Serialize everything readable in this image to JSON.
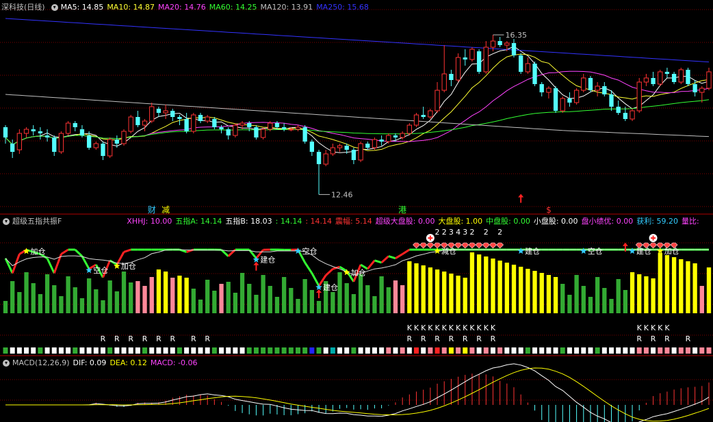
{
  "panels": {
    "main": {
      "title": "深科技(日线)",
      "ma_labels": [
        {
          "text": "MA5: 14.85",
          "color": "#ffffff"
        },
        {
          "text": "MA10: 14.87",
          "color": "#ffff33"
        },
        {
          "text": "MA20: 14.76",
          "color": "#ff44ff"
        },
        {
          "text": "MA60: 14.25",
          "color": "#33ff33"
        },
        {
          "text": "MA120: 13.91",
          "color": "#c0c0c0"
        },
        {
          "text": "MA250: 15.68",
          "color": "#3333ff"
        }
      ],
      "high_label": "16.35",
      "low_label": "12.46",
      "signals": [
        {
          "text": "财",
          "color": "#33ccff"
        },
        {
          "text": "减",
          "color": "#ffff00"
        },
        {
          "text": "港",
          "color": "#33ff33"
        },
        {
          "text": "$",
          "color": "#ff3333"
        }
      ]
    },
    "indicator": {
      "title": "超级五指共振F",
      "labels": [
        {
          "text": "XHHJ: 10.00",
          "color": "#ff44ff"
        },
        {
          "text": "五指A: 14.14",
          "color": "#33ff33"
        },
        {
          "text": "五指B: 18.03",
          "color": "#ffffff"
        },
        {
          "text": ": 14.14",
          "color": "#33ff33"
        },
        {
          "text": ": 14.14",
          "color": "#ff3333"
        },
        {
          "text": "震幅: 5.14",
          "color": "#ff3333"
        },
        {
          "text": "超级大盘股: 0.00",
          "color": "#ff44ff"
        },
        {
          "text": "大盘股: 1.00",
          "color": "#ffff00"
        },
        {
          "text": "中盘股: 0.00",
          "color": "#33ff33"
        },
        {
          "text": "小盘股: 0.00",
          "color": "#ffffff"
        },
        {
          "text": "盘小绩优: 0.00",
          "color": "#ff44ff"
        },
        {
          "text": "获利: 59.20",
          "color": "#33ccff"
        },
        {
          "text": "量比:",
          "color": "#ff44ff"
        }
      ],
      "digit_row": [
        "2",
        "2",
        "3",
        "4",
        "3",
        "2",
        "2",
        "2"
      ],
      "k_mark": "K",
      "r_mark": "R",
      "annotations": [
        {
          "text": "加仓",
          "star": "#ffff00"
        },
        {
          "text": "空仓",
          "star": "#33ccff"
        },
        {
          "text": "加仓",
          "star": "#ffff00"
        },
        {
          "text": "建仓",
          "star": "#33ccff"
        },
        {
          "text": "空仓",
          "star": "#33ccff"
        },
        {
          "text": "建仓",
          "star": "#33ccff"
        },
        {
          "text": "加仓",
          "star": "#ffff00"
        },
        {
          "text": "减仓",
          "star": "#ffff00"
        },
        {
          "text": "建仓",
          "star": "#33ccff"
        },
        {
          "text": "空仓",
          "star": "#33ccff"
        },
        {
          "text": "建仓",
          "star": "#33ccff"
        },
        {
          "text": "加仓",
          "star": "#ffff00"
        }
      ]
    },
    "macd": {
      "title": "MACD(12,26,9)",
      "labels": [
        {
          "text": "DIF: 0.09",
          "color": "#ffffff"
        },
        {
          "text": "DEA: 0.12",
          "color": "#ffff00"
        },
        {
          "text": "MACD: -0.06",
          "color": "#ff44ff"
        }
      ]
    }
  },
  "colors": {
    "up": "#ff3333",
    "down": "#54ffff",
    "grid": "#7f0000",
    "ma5": "#ffffff",
    "ma10": "#ffff33",
    "ma20": "#ff44ff",
    "ma60": "#33ff33",
    "ma120": "#c0c0c0",
    "ma250": "#3333ff"
  },
  "chart_data": {
    "type": "candlestick",
    "price_range": [
      12.2,
      16.9
    ],
    "candles_ohlc": [
      [
        14.1,
        14.15,
        13.7,
        13.85
      ],
      [
        13.7,
        13.8,
        13.35,
        13.5
      ],
      [
        13.55,
        14.05,
        13.45,
        13.95
      ],
      [
        13.95,
        14.1,
        13.85,
        14.05
      ],
      [
        14.05,
        14.15,
        13.9,
        14.0
      ],
      [
        14.0,
        14.1,
        13.8,
        13.95
      ],
      [
        13.9,
        14.05,
        13.75,
        13.85
      ],
      [
        13.85,
        13.9,
        13.4,
        13.5
      ],
      [
        13.5,
        14.0,
        13.45,
        13.95
      ],
      [
        13.95,
        14.25,
        13.9,
        14.2
      ],
      [
        14.2,
        14.25,
        14.0,
        14.1
      ],
      [
        14.05,
        14.15,
        13.85,
        13.9
      ],
      [
        13.9,
        14.0,
        13.55,
        13.6
      ],
      [
        13.6,
        13.75,
        13.55,
        13.7
      ],
      [
        13.7,
        13.75,
        13.3,
        13.4
      ],
      [
        13.4,
        13.85,
        13.35,
        13.8
      ],
      [
        13.8,
        13.9,
        13.6,
        13.7
      ],
      [
        13.7,
        14.05,
        13.65,
        14.0
      ],
      [
        14.0,
        14.4,
        13.95,
        14.35
      ],
      [
        14.35,
        14.5,
        14.1,
        14.15
      ],
      [
        14.15,
        14.3,
        14.0,
        14.25
      ],
      [
        14.25,
        14.7,
        14.2,
        14.6
      ],
      [
        14.55,
        14.6,
        14.35,
        14.45
      ],
      [
        14.45,
        14.65,
        14.3,
        14.5
      ],
      [
        14.5,
        14.55,
        14.25,
        14.35
      ],
      [
        14.35,
        14.4,
        14.15,
        14.3
      ],
      [
        14.3,
        14.45,
        13.95,
        14.0
      ],
      [
        14.0,
        14.45,
        13.95,
        14.4
      ],
      [
        14.4,
        14.45,
        14.2,
        14.25
      ],
      [
        14.25,
        14.4,
        14.2,
        14.35
      ],
      [
        14.3,
        14.35,
        14.05,
        14.1
      ],
      [
        14.1,
        14.15,
        13.95,
        14.05
      ],
      [
        14.05,
        14.1,
        13.8,
        13.9
      ],
      [
        13.9,
        14.2,
        13.85,
        14.15
      ],
      [
        14.15,
        14.25,
        14.05,
        14.2
      ],
      [
        14.2,
        14.25,
        14.0,
        14.1
      ],
      [
        14.1,
        14.15,
        13.8,
        13.85
      ],
      [
        13.85,
        14.1,
        13.8,
        14.05
      ],
      [
        14.05,
        14.25,
        14.0,
        14.2
      ],
      [
        14.2,
        14.25,
        14.05,
        14.1
      ],
      [
        14.1,
        14.2,
        14.0,
        14.05
      ],
      [
        14.05,
        14.1,
        14.0,
        14.05
      ],
      [
        14.05,
        14.15,
        14.0,
        14.1
      ],
      [
        14.1,
        14.15,
        13.7,
        13.75
      ],
      [
        13.75,
        13.8,
        13.4,
        13.5
      ],
      [
        13.5,
        13.55,
        12.46,
        13.2
      ],
      [
        13.2,
        13.55,
        13.15,
        13.45
      ],
      [
        13.45,
        13.7,
        13.4,
        13.6
      ],
      [
        13.6,
        13.7,
        13.5,
        13.65
      ],
      [
        13.65,
        13.7,
        13.45,
        13.55
      ],
      [
        13.55,
        13.6,
        13.2,
        13.3
      ],
      [
        13.3,
        13.75,
        13.25,
        13.7
      ],
      [
        13.7,
        13.75,
        13.55,
        13.6
      ],
      [
        13.6,
        13.85,
        13.55,
        13.8
      ],
      [
        13.8,
        13.9,
        13.65,
        13.75
      ],
      [
        13.75,
        13.95,
        13.7,
        13.9
      ],
      [
        13.9,
        13.95,
        13.75,
        13.85
      ],
      [
        13.85,
        14.0,
        13.8,
        13.95
      ],
      [
        13.95,
        14.2,
        13.9,
        14.15
      ],
      [
        14.15,
        14.45,
        14.1,
        14.4
      ],
      [
        14.4,
        14.6,
        14.3,
        14.35
      ],
      [
        14.35,
        14.55,
        14.3,
        14.5
      ],
      [
        14.5,
        15.2,
        14.45,
        15.0
      ],
      [
        15.0,
        16.1,
        14.95,
        15.4
      ],
      [
        15.4,
        15.5,
        15.1,
        15.25
      ],
      [
        15.25,
        15.9,
        15.2,
        15.8
      ],
      [
        15.8,
        16.0,
        15.6,
        15.75
      ],
      [
        15.75,
        16.05,
        15.7,
        16.0
      ],
      [
        15.95,
        16.0,
        15.4,
        15.45
      ],
      [
        15.45,
        16.2,
        15.4,
        16.05
      ],
      [
        16.05,
        16.35,
        15.95,
        16.2
      ],
      [
        16.2,
        16.3,
        16.05,
        16.1
      ],
      [
        16.1,
        16.2,
        15.95,
        16.15
      ],
      [
        16.15,
        16.25,
        15.8,
        15.85
      ],
      [
        15.85,
        15.9,
        15.4,
        15.45
      ],
      [
        15.45,
        15.8,
        15.4,
        15.65
      ],
      [
        15.65,
        15.7,
        15.1,
        15.15
      ],
      [
        15.15,
        15.2,
        14.85,
        14.95
      ],
      [
        14.95,
        15.1,
        14.8,
        15.05
      ],
      [
        15.05,
        15.1,
        14.45,
        14.5
      ],
      [
        14.5,
        14.85,
        14.45,
        14.8
      ],
      [
        14.8,
        14.95,
        14.6,
        14.7
      ],
      [
        14.7,
        15.05,
        14.65,
        15.0
      ],
      [
        15.0,
        15.4,
        14.95,
        15.3
      ],
      [
        15.3,
        15.35,
        14.95,
        15.0
      ],
      [
        15.0,
        15.2,
        14.85,
        15.1
      ],
      [
        15.1,
        15.2,
        14.85,
        14.9
      ],
      [
        14.9,
        15.0,
        14.5,
        14.6
      ],
      [
        14.6,
        14.75,
        14.4,
        14.45
      ],
      [
        14.45,
        14.6,
        14.25,
        14.3
      ],
      [
        14.3,
        14.55,
        14.25,
        14.5
      ],
      [
        14.5,
        15.3,
        14.45,
        15.2
      ],
      [
        15.2,
        15.4,
        15.1,
        15.3
      ],
      [
        15.3,
        15.45,
        15.1,
        15.15
      ],
      [
        15.15,
        15.5,
        15.1,
        15.45
      ],
      [
        15.45,
        15.55,
        15.3,
        15.4
      ],
      [
        15.4,
        15.45,
        15.15,
        15.2
      ],
      [
        15.2,
        15.55,
        15.15,
        15.5
      ],
      [
        15.5,
        15.55,
        15.1,
        15.15
      ],
      [
        15.15,
        15.25,
        14.85,
        14.95
      ],
      [
        14.95,
        15.1,
        14.7,
        15.05
      ],
      [
        15.05,
        15.55,
        15.0,
        15.45
      ]
    ]
  }
}
